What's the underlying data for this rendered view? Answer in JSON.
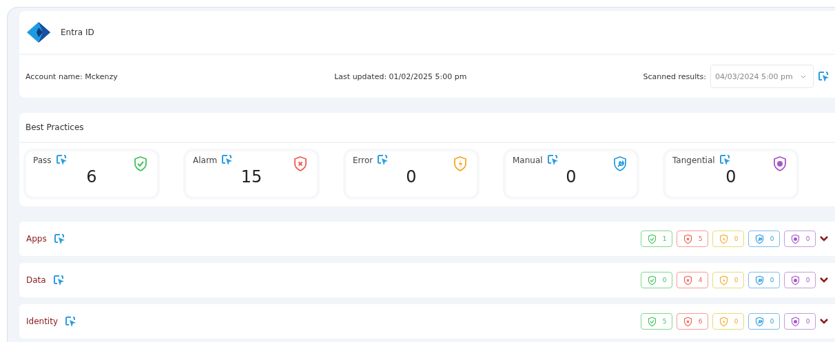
{
  "header": {
    "title": "Entra ID",
    "account": "Account name: Mckenzy",
    "last_updated": "Last updated: 01/02/2025 5:00 pm",
    "scanned_label": "Scanned results:",
    "scanned_value": "04/03/2024 5:00 pm"
  },
  "best_practices": {
    "title": "Best Practices",
    "stats": [
      {
        "kind": "pass",
        "label": "Pass",
        "value": "6"
      },
      {
        "kind": "alarm",
        "label": "Alarm",
        "value": "15"
      },
      {
        "kind": "error",
        "label": "Error",
        "value": "0"
      },
      {
        "kind": "manual",
        "label": "Manual",
        "value": "0"
      },
      {
        "kind": "tangential",
        "label": "Tangential",
        "value": "0"
      }
    ]
  },
  "sections": [
    {
      "title": "Apps",
      "expanded": false,
      "counts": [
        {
          "kind": "pass",
          "value": "1"
        },
        {
          "kind": "alarm",
          "value": "5"
        },
        {
          "kind": "error",
          "value": "0"
        },
        {
          "kind": "manual",
          "value": "0"
        },
        {
          "kind": "tangential",
          "value": "0"
        }
      ]
    },
    {
      "title": "Data",
      "expanded": false,
      "counts": [
        {
          "kind": "pass",
          "value": "0"
        },
        {
          "kind": "alarm",
          "value": "4"
        },
        {
          "kind": "error",
          "value": "0"
        },
        {
          "kind": "manual",
          "value": "0"
        },
        {
          "kind": "tangential",
          "value": "0"
        }
      ]
    },
    {
      "title": "Identity",
      "expanded": false,
      "counts": [
        {
          "kind": "pass",
          "value": "5"
        },
        {
          "kind": "alarm",
          "value": "6"
        },
        {
          "kind": "error",
          "value": "0"
        },
        {
          "kind": "manual",
          "value": "0"
        },
        {
          "kind": "tangential",
          "value": "0"
        }
      ]
    }
  ]
}
